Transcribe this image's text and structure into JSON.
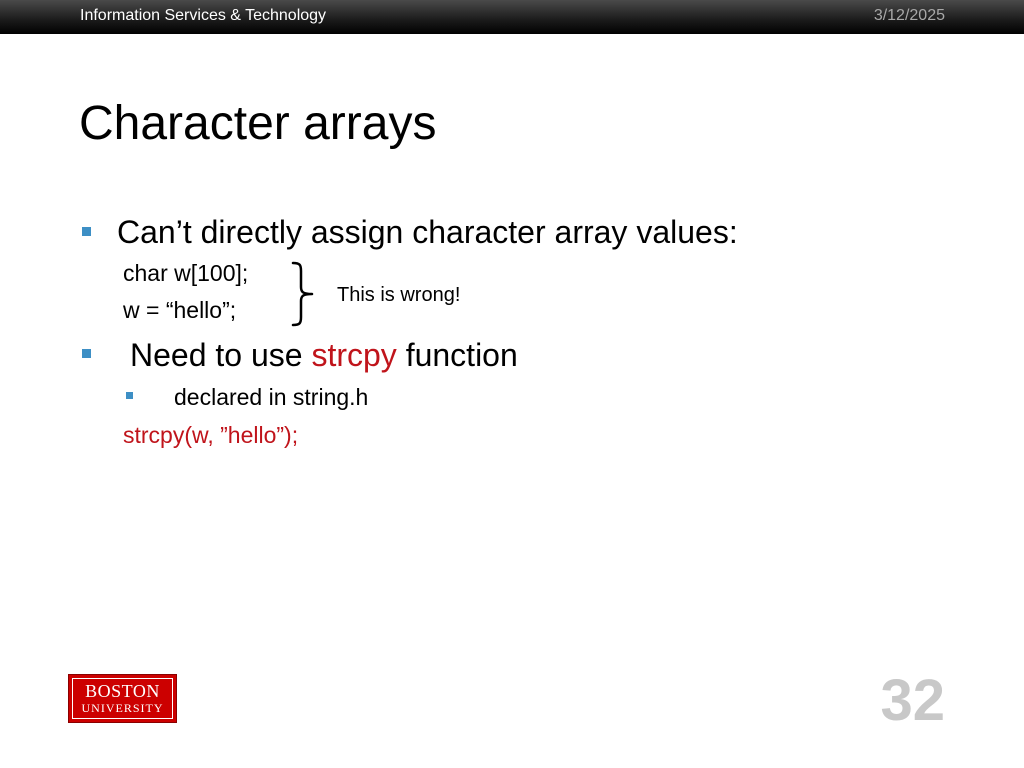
{
  "header": {
    "organization": "Information Services & Technology",
    "date": "3/12/2025"
  },
  "slide": {
    "title": "Character arrays",
    "bullet1": {
      "text": "Can’t directly assign character array values:",
      "code_line1": "char w[100];",
      "code_line2": "w = “hello”;",
      "annotation": "This is wrong!"
    },
    "bullet2": {
      "text_before": "Need to use ",
      "highlight": "strcpy",
      "text_after": " function",
      "sub_bullet": "declared in string.h",
      "code_example": "strcpy(w, ”hello”);"
    }
  },
  "footer": {
    "logo_line1": "BOSTON",
    "logo_line2": "UNIVERSITY",
    "page_number": "32"
  },
  "colors": {
    "bullet": "#3d8fc5",
    "highlight": "#c0141b",
    "logo_background": "#cc0000",
    "page_number": "#c8c8c8"
  },
  "icons": {
    "annotation_bracket": "right-curly-brace-icon"
  }
}
